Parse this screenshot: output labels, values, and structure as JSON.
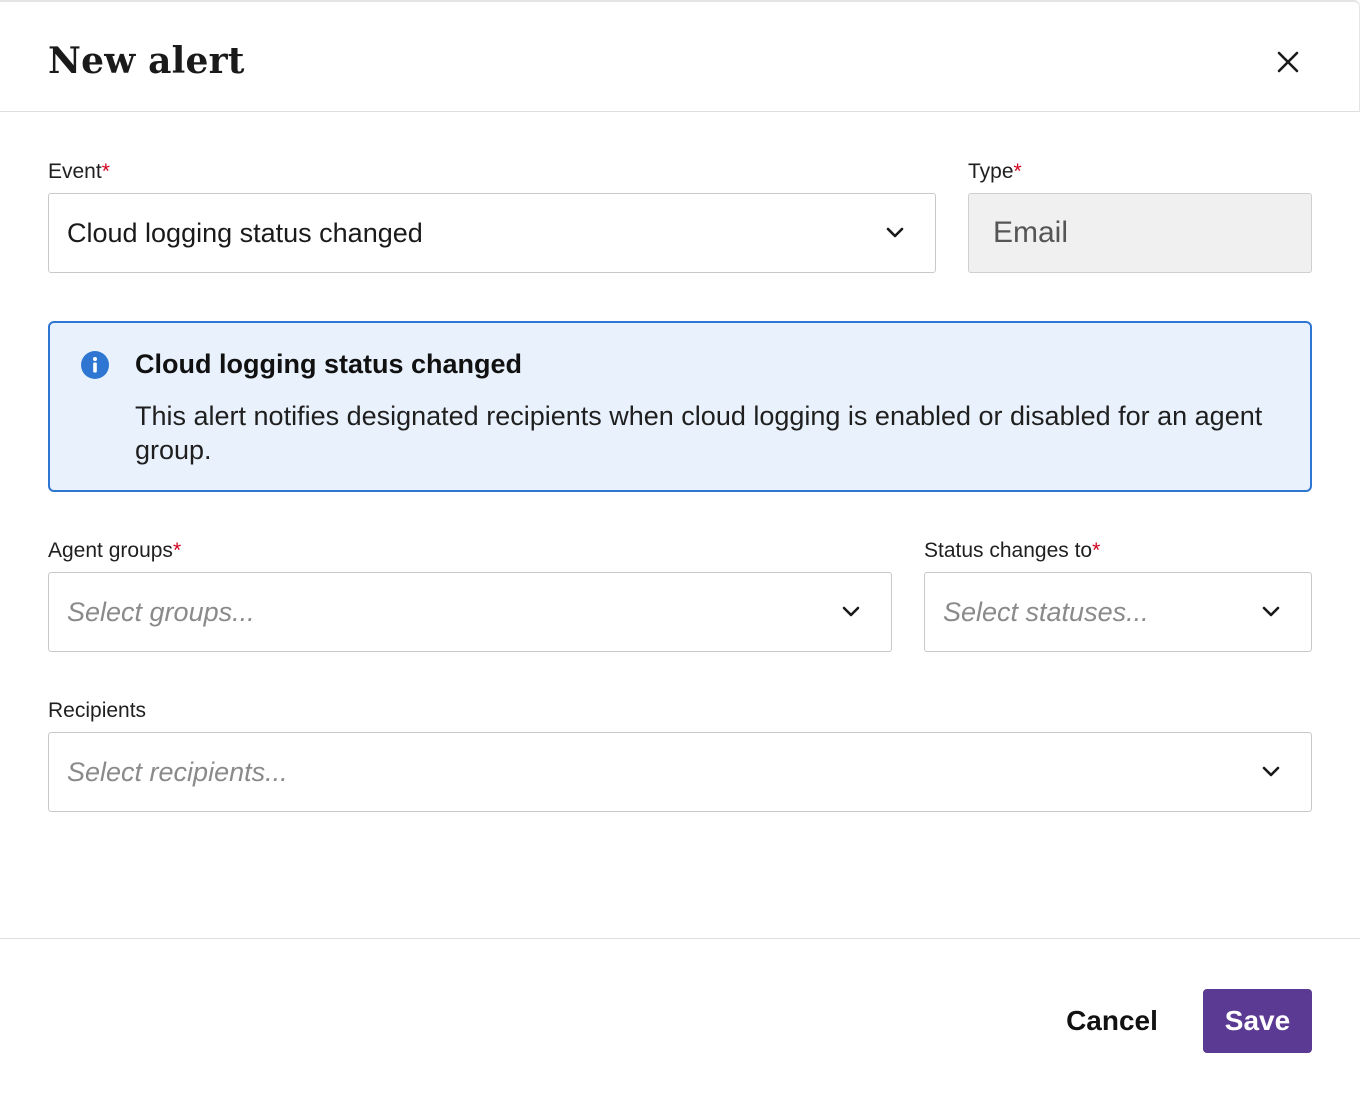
{
  "dialog": {
    "title": "New alert"
  },
  "form": {
    "event": {
      "label": "Event",
      "required_mark": "*",
      "value": "Cloud logging status changed"
    },
    "type": {
      "label": "Type",
      "required_mark": "*",
      "value": "Email"
    },
    "info": {
      "title": "Cloud logging status changed",
      "body": "This alert notifies designated recipients when cloud logging is enabled or disabled for an agent group."
    },
    "agent_groups": {
      "label": "Agent groups",
      "required_mark": "*",
      "placeholder": "Select groups..."
    },
    "status_changes_to": {
      "label": "Status changes to",
      "required_mark": "*",
      "placeholder": "Select statuses..."
    },
    "recipients": {
      "label": "Recipients",
      "placeholder": "Select recipients..."
    }
  },
  "footer": {
    "cancel_label": "Cancel",
    "save_label": "Save"
  },
  "colors": {
    "accent": "#5b3a93",
    "info_border": "#2f76d2",
    "info_bg": "#e9f2fc",
    "required": "#d0021b"
  },
  "icons": {
    "close": "close-icon",
    "chevron": "chevron-down-icon",
    "info": "info-icon"
  }
}
